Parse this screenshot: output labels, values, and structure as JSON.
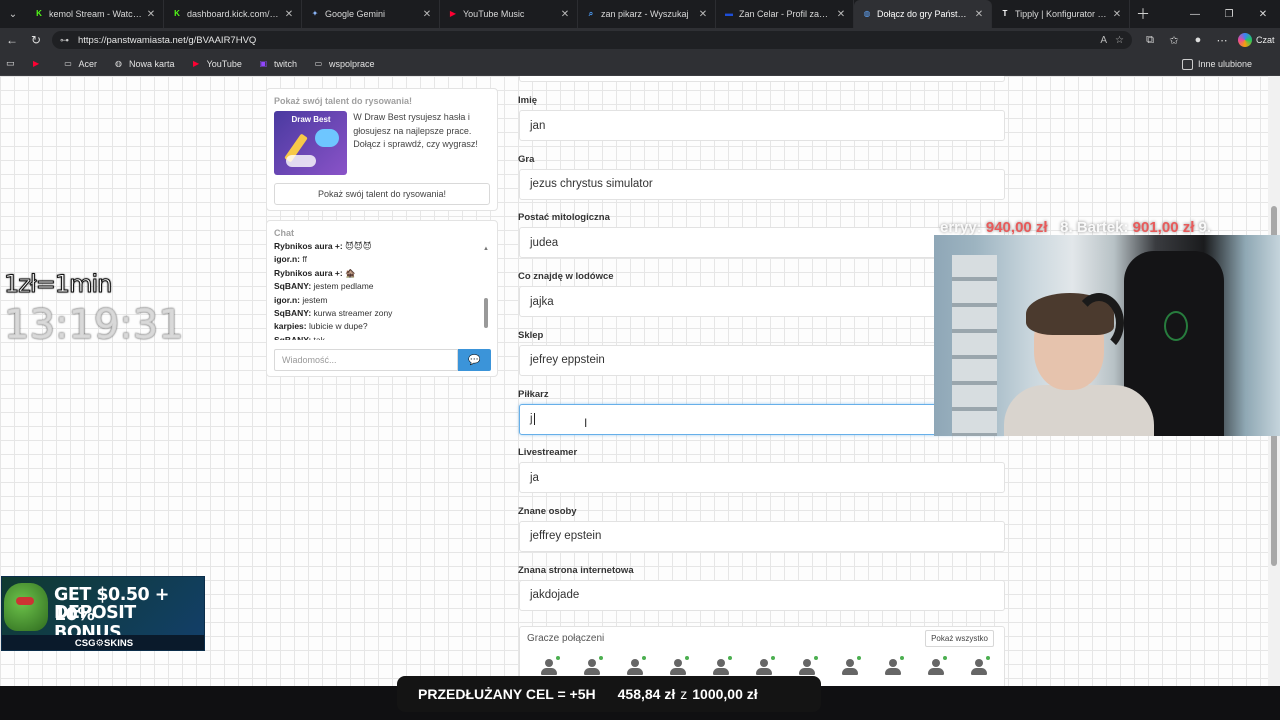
{
  "tabs": [
    {
      "title": "kemol Stream - Watch Live o",
      "icon": "kick-icon",
      "color": "#53fc18",
      "glyph": "K",
      "active": false
    },
    {
      "title": "dashboard.kick.com/stream",
      "icon": "kick-icon",
      "color": "#53fc18",
      "glyph": "K",
      "active": false
    },
    {
      "title": "Google Gemini",
      "icon": "gemini-icon",
      "color": "#8ab4f8",
      "glyph": "✦",
      "active": false
    },
    {
      "title": "YouTube Music",
      "icon": "youtube-music-icon",
      "color": "#ff0033",
      "glyph": "▶",
      "active": false
    },
    {
      "title": "zan pikarz - Wyszukaj",
      "icon": "search-icon",
      "color": "#4ea1ff",
      "glyph": "⌕",
      "active": false
    },
    {
      "title": "Zan Celar - Profil zawodnika",
      "icon": "site-icon",
      "color": "#1d4ed8",
      "glyph": "▬",
      "active": false
    },
    {
      "title": "Dołącz do gry Państwa Miasta",
      "icon": "globe-icon",
      "color": "#60a5fa",
      "glyph": "◍",
      "active": true
    },
    {
      "title": "Tipply | Konfigurator (Twój c",
      "icon": "tipply-icon",
      "color": "#ffffff",
      "glyph": "T",
      "active": false
    }
  ],
  "browser": {
    "url": "https://panstwamiasta.net/g/BVAAIR7HVQ",
    "copilot_label": "Czat"
  },
  "bookmarks": {
    "items": [
      {
        "label": "",
        "icon": "youtube-icon"
      },
      {
        "label": "Acer",
        "icon": "folder-icon"
      },
      {
        "label": "Nowa karta",
        "icon": "globe-icon"
      },
      {
        "label": "YouTube",
        "icon": "youtube-icon"
      },
      {
        "label": "twitch",
        "icon": "twitch-icon"
      },
      {
        "label": "wspolprace",
        "icon": "folder-icon"
      }
    ],
    "other": "Inne ulubione"
  },
  "drawbest": {
    "title": "Pokaż swój talent do rysowania!",
    "image_label": "Draw Best",
    "description": "W Draw Best rysujesz hasła i głosujesz na najlepsze prace. Dołącz i sprawdź, czy wygrasz!",
    "button": "Pokaż swój talent do rysowania!"
  },
  "chat": {
    "title": "Chat",
    "messages": [
      {
        "user": "Rybnikos aura +:",
        "text": "😈😈😈"
      },
      {
        "user": "igor.n:",
        "text": "ff"
      },
      {
        "user": "Rybnikos aura +:",
        "text": "🏚️"
      },
      {
        "user": "SqBANY:",
        "text": "jestem pedlame"
      },
      {
        "user": "igor.n:",
        "text": "jestem"
      },
      {
        "user": "SqBANY:",
        "text": "kurwa streamer zony"
      },
      {
        "user": "karpies:",
        "text": "lubicie w dupe?"
      },
      {
        "user": "SqBANY:",
        "text": "tak"
      }
    ],
    "input_placeholder": "Wiadomość..."
  },
  "form": {
    "fields": [
      {
        "label": "Imię",
        "value": "jan"
      },
      {
        "label": "Gra",
        "value": "jezus chrystus simulator"
      },
      {
        "label": "Postać mitologiczna",
        "value": "judea"
      },
      {
        "label": "Co znajdę w lodówce",
        "value": "jajka"
      },
      {
        "label": "Sklep",
        "value": "jefrey eppstein"
      },
      {
        "label": "Piłkarz",
        "value": "j"
      },
      {
        "label": "Livestreamer",
        "value": "ja"
      },
      {
        "label": "Znane osoby",
        "value": "jeffrey epstein"
      },
      {
        "label": "Znana strona internetowa",
        "value": "jakdojade"
      }
    ]
  },
  "players": {
    "title": "Gracze połączeni",
    "show_all": "Pokaż wszystko",
    "count": 11
  },
  "overlay": {
    "rate": "1zł=1min",
    "clock": "13:19:31",
    "ticker_prefix": "erryy:",
    "ticker_value1": "940,00 zł",
    "ticker_rank": "8. Bartek:",
    "ticker_value2": "901,00 zł",
    "ticker_tail": "9."
  },
  "ad": {
    "line1": "GET $0.50 + 10%",
    "line2": "DEPOSIT BONUS",
    "brand": "CSG⚙SKINS"
  },
  "goal": {
    "label": "PRZEDŁUŻANY CEL = +5H",
    "current": "458,84 zł",
    "sep": "z",
    "target": "1000,00 zł"
  }
}
